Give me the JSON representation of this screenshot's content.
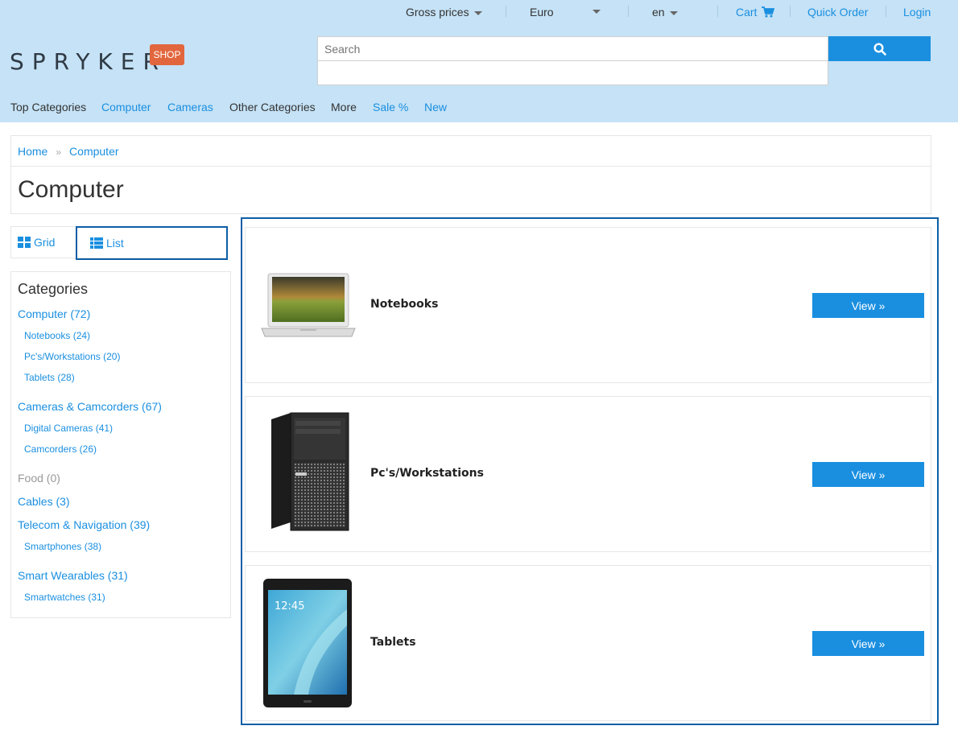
{
  "topbar": {
    "price_mode": "Gross prices",
    "currency": "Euro",
    "language": "en",
    "cart": "Cart",
    "quick_order": "Quick Order",
    "login": "Login"
  },
  "logo": {
    "text": "SPRYKER",
    "badge": "SHOP"
  },
  "search": {
    "placeholder": "Search"
  },
  "nav": {
    "items": [
      {
        "label": "Top Categories"
      },
      {
        "label": "Computer"
      },
      {
        "label": "Cameras"
      },
      {
        "label": "Other Categories"
      },
      {
        "label": "More"
      },
      {
        "label": "Sale %"
      },
      {
        "label": "New"
      }
    ]
  },
  "breadcrumb": {
    "home": "Home",
    "separator": "»",
    "current": "Computer"
  },
  "page": {
    "title": "Computer"
  },
  "view_toggle": {
    "grid": "Grid",
    "list": "List"
  },
  "categories": {
    "title": "Categories",
    "items": [
      {
        "label": "Computer (72)"
      },
      {
        "label": "Notebooks (24)"
      },
      {
        "label": "Pc's/Workstations (20)"
      },
      {
        "label": "Tablets (28)"
      },
      {
        "label": "Cameras & Camcorders (67)"
      },
      {
        "label": "Digital Cameras (41)"
      },
      {
        "label": "Camcorders (26)"
      },
      {
        "label": "Food (0)"
      },
      {
        "label": "Cables (3)"
      },
      {
        "label": "Telecom & Navigation (39)"
      },
      {
        "label": "Smartphones (38)"
      },
      {
        "label": "Smart Wearables (31)"
      },
      {
        "label": "Smartwatches (31)"
      }
    ]
  },
  "products": [
    {
      "name": "Notebooks",
      "button": "View »"
    },
    {
      "name": "Pc's/Workstations",
      "button": "View »"
    },
    {
      "name": "Tablets",
      "button": "View »"
    }
  ],
  "colors": {
    "header_bg": "#c5e2f6",
    "link": "#1a8fe0",
    "badge": "#e2663d",
    "focus_border": "#0d5ea6"
  },
  "icons": [
    "caret-down-icon",
    "cart-icon",
    "search-icon",
    "grid-icon",
    "list-icon"
  ]
}
